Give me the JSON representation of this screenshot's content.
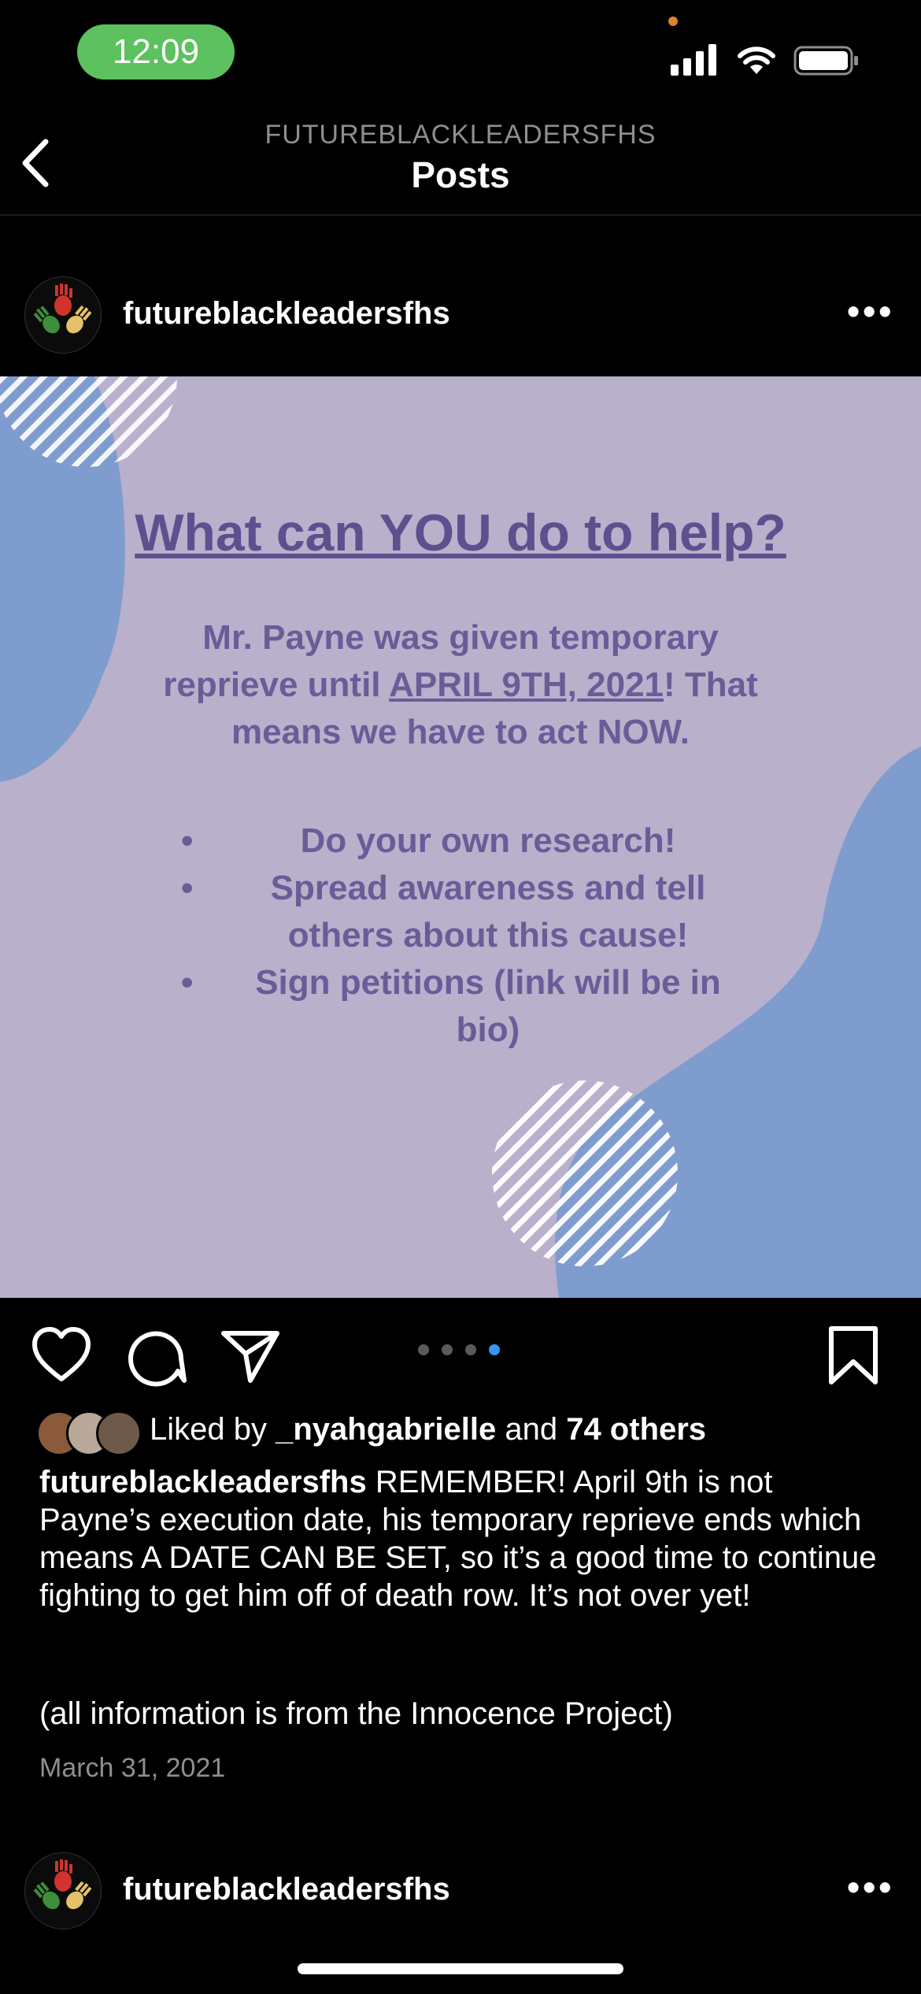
{
  "status_bar": {
    "time": "12:09"
  },
  "header": {
    "account_name": "FUTUREBLACKLEADERSFHS",
    "title": "Posts"
  },
  "post": {
    "username": "futureblackleadersfhs",
    "image": {
      "heading": "What can YOU do to help?",
      "para_1": "Mr. Payne was given temporary reprieve until ",
      "para_date": "APRIL 9TH, 2021",
      "para_2": "! That means we have to act NOW.",
      "bullets": [
        "Do your own research!",
        "Spread awareness and tell others about this cause!",
        "Sign petitions (link will be in bio)"
      ]
    },
    "carousel": {
      "count": 4,
      "active_index": 4
    },
    "likes": {
      "prefix": "Liked by ",
      "first_user": "_nyahgabrielle",
      "middle": " and ",
      "others": "74 others"
    },
    "caption": {
      "username": "futureblackleadersfhs",
      "text": " REMEMBER! April 9th is not Payne’s execution date, his temporary reprieve ends which means A DATE CAN BE SET, so it’s a good time to continue fighting to get him off of death row. It’s not over yet!",
      "note": "(all information is from the Innocence Project)"
    },
    "date": "March 31, 2021"
  },
  "next_post": {
    "username": "futureblackleadersfhs"
  },
  "colors": {
    "background": "#000000",
    "status_pill": "#5cc15e",
    "image_bg": "#b9b0cc",
    "image_blob": "#7f9ccf",
    "image_text": "#6b5c98",
    "carousel_active": "#3897f0"
  }
}
